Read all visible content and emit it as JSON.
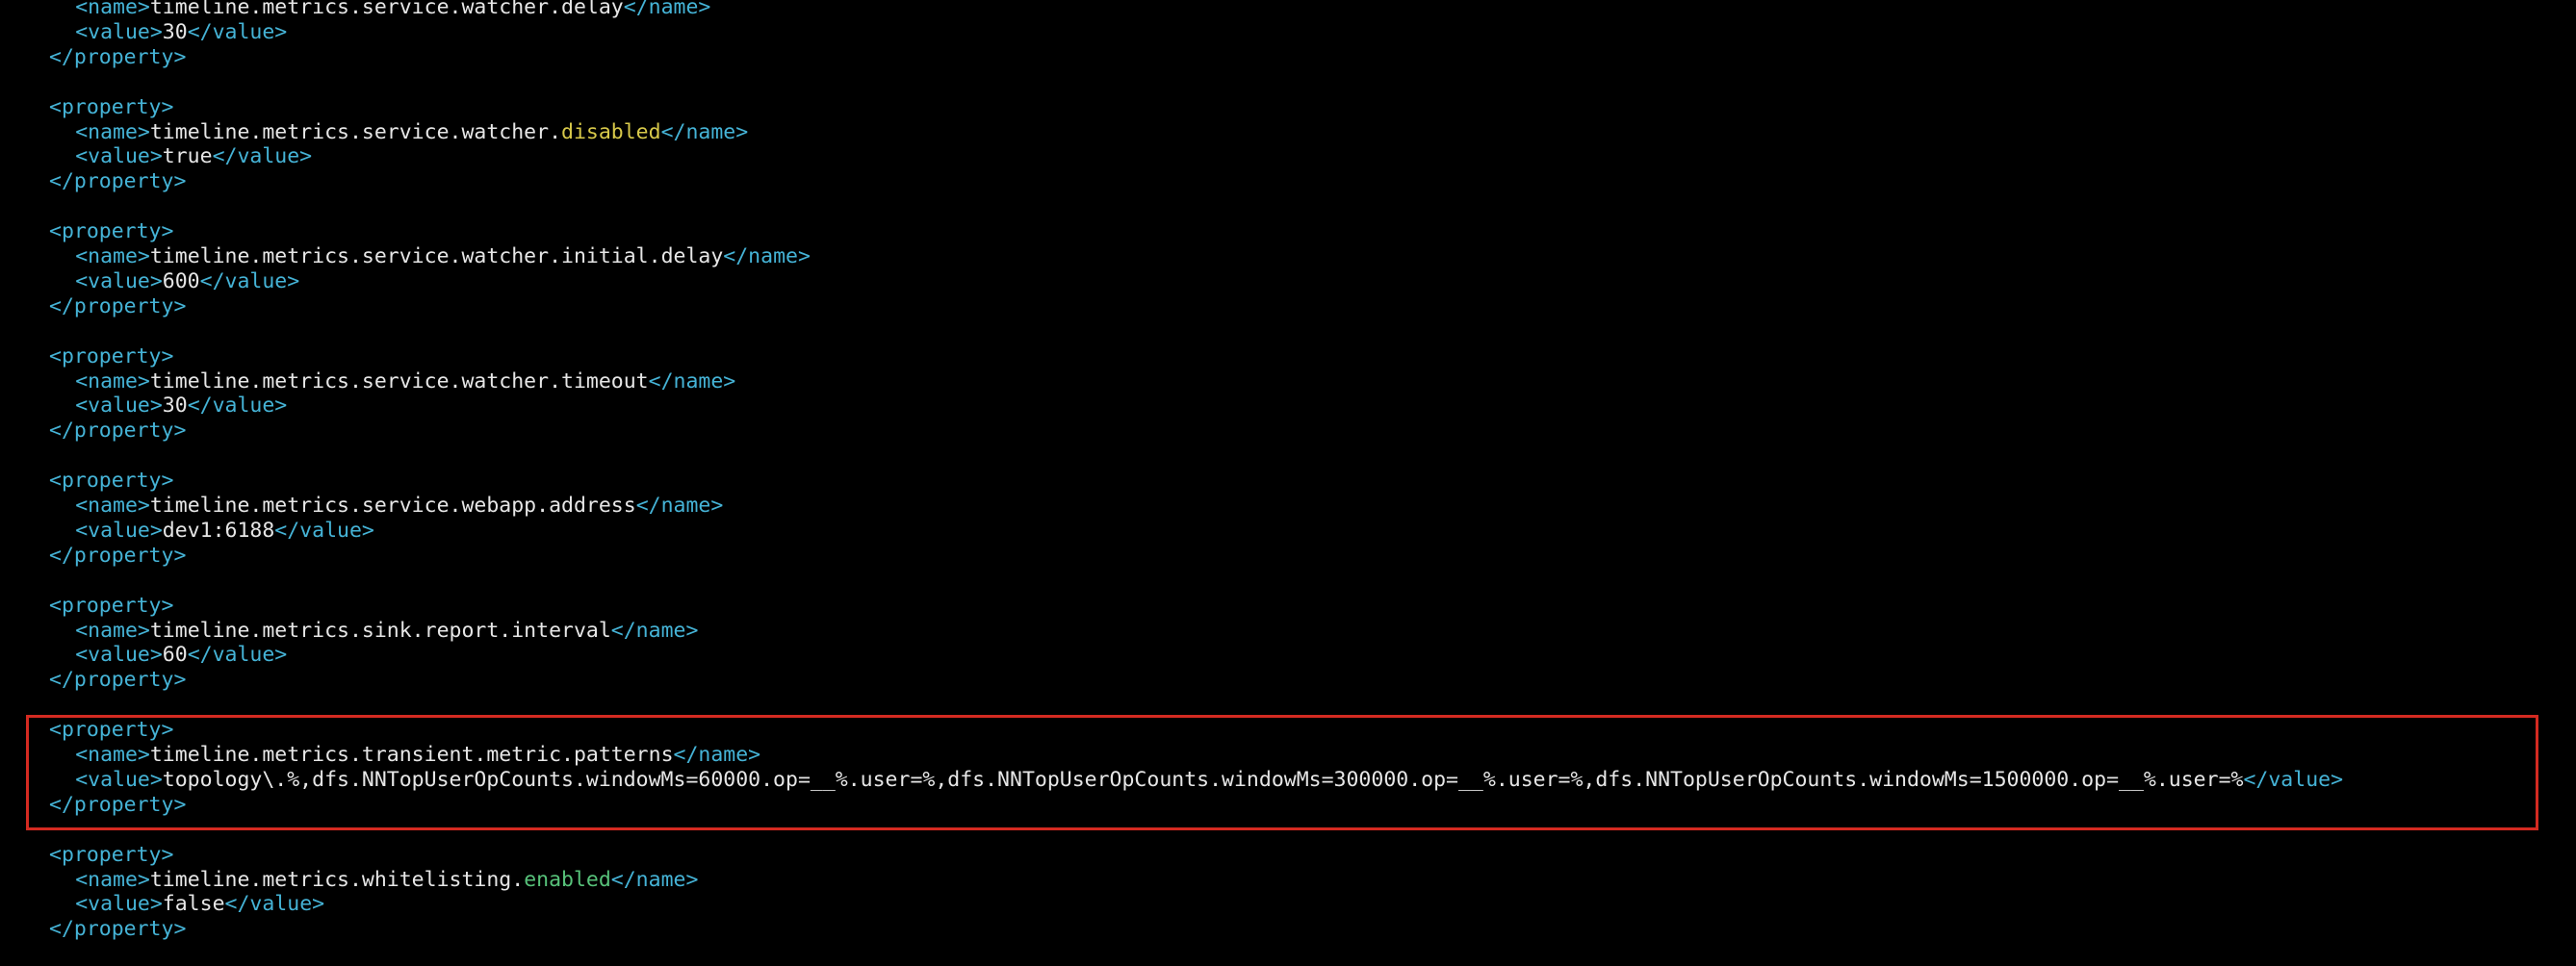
{
  "terminal": {
    "lines": [
      {
        "indent": 2,
        "parts": [
          {
            "t": "tag",
            "s": "<name>"
          },
          {
            "t": "txt",
            "s": "timeline.metrics.service.watcher.delay"
          },
          {
            "t": "tag",
            "s": "</name>"
          }
        ]
      },
      {
        "indent": 2,
        "parts": [
          {
            "t": "tag",
            "s": "<value>"
          },
          {
            "t": "txt",
            "s": "30"
          },
          {
            "t": "tag",
            "s": "</value>"
          }
        ]
      },
      {
        "indent": 0,
        "parts": [
          {
            "t": "tag",
            "s": "</property>"
          }
        ]
      },
      {
        "indent": 0,
        "parts": []
      },
      {
        "indent": 0,
        "parts": [
          {
            "t": "tag",
            "s": "<property>"
          }
        ]
      },
      {
        "indent": 2,
        "parts": [
          {
            "t": "tag",
            "s": "<name>"
          },
          {
            "t": "txt",
            "s": "timeline.metrics.service.watcher."
          },
          {
            "t": "kw-yellow",
            "s": "disabled"
          },
          {
            "t": "tag",
            "s": "</name>"
          }
        ]
      },
      {
        "indent": 2,
        "parts": [
          {
            "t": "tag",
            "s": "<value>"
          },
          {
            "t": "txt",
            "s": "true"
          },
          {
            "t": "tag",
            "s": "</value>"
          }
        ]
      },
      {
        "indent": 0,
        "parts": [
          {
            "t": "tag",
            "s": "</property>"
          }
        ]
      },
      {
        "indent": 0,
        "parts": []
      },
      {
        "indent": 0,
        "parts": [
          {
            "t": "tag",
            "s": "<property>"
          }
        ]
      },
      {
        "indent": 2,
        "parts": [
          {
            "t": "tag",
            "s": "<name>"
          },
          {
            "t": "txt",
            "s": "timeline.metrics.service.watcher.initial.delay"
          },
          {
            "t": "tag",
            "s": "</name>"
          }
        ]
      },
      {
        "indent": 2,
        "parts": [
          {
            "t": "tag",
            "s": "<value>"
          },
          {
            "t": "txt",
            "s": "600"
          },
          {
            "t": "tag",
            "s": "</value>"
          }
        ]
      },
      {
        "indent": 0,
        "parts": [
          {
            "t": "tag",
            "s": "</property>"
          }
        ]
      },
      {
        "indent": 0,
        "parts": []
      },
      {
        "indent": 0,
        "parts": [
          {
            "t": "tag",
            "s": "<property>"
          }
        ]
      },
      {
        "indent": 2,
        "parts": [
          {
            "t": "tag",
            "s": "<name>"
          },
          {
            "t": "txt",
            "s": "timeline.metrics.service.watcher.timeout"
          },
          {
            "t": "tag",
            "s": "</name>"
          }
        ]
      },
      {
        "indent": 2,
        "parts": [
          {
            "t": "tag",
            "s": "<value>"
          },
          {
            "t": "txt",
            "s": "30"
          },
          {
            "t": "tag",
            "s": "</value>"
          }
        ]
      },
      {
        "indent": 0,
        "parts": [
          {
            "t": "tag",
            "s": "</property>"
          }
        ]
      },
      {
        "indent": 0,
        "parts": []
      },
      {
        "indent": 0,
        "parts": [
          {
            "t": "tag",
            "s": "<property>"
          }
        ]
      },
      {
        "indent": 2,
        "parts": [
          {
            "t": "tag",
            "s": "<name>"
          },
          {
            "t": "txt",
            "s": "timeline.metrics.service.webapp.address"
          },
          {
            "t": "tag",
            "s": "</name>"
          }
        ]
      },
      {
        "indent": 2,
        "parts": [
          {
            "t": "tag",
            "s": "<value>"
          },
          {
            "t": "txt",
            "s": "dev1:6188"
          },
          {
            "t": "tag",
            "s": "</value>"
          }
        ]
      },
      {
        "indent": 0,
        "parts": [
          {
            "t": "tag",
            "s": "</property>"
          }
        ]
      },
      {
        "indent": 0,
        "parts": []
      },
      {
        "indent": 0,
        "parts": [
          {
            "t": "tag",
            "s": "<property>"
          }
        ]
      },
      {
        "indent": 2,
        "parts": [
          {
            "t": "tag",
            "s": "<name>"
          },
          {
            "t": "txt",
            "s": "timeline.metrics.sink.report.interval"
          },
          {
            "t": "tag",
            "s": "</name>"
          }
        ]
      },
      {
        "indent": 2,
        "parts": [
          {
            "t": "tag",
            "s": "<value>"
          },
          {
            "t": "txt",
            "s": "60"
          },
          {
            "t": "tag",
            "s": "</value>"
          }
        ]
      },
      {
        "indent": 0,
        "parts": [
          {
            "t": "tag",
            "s": "</property>"
          }
        ]
      },
      {
        "indent": 0,
        "parts": []
      },
      {
        "indent": 0,
        "parts": [
          {
            "t": "tag",
            "s": "<property>"
          }
        ]
      },
      {
        "indent": 2,
        "parts": [
          {
            "t": "tag",
            "s": "<name>"
          },
          {
            "t": "txt",
            "s": "timeline.metrics.transient.metric.patterns"
          },
          {
            "t": "tag",
            "s": "</name>"
          }
        ]
      },
      {
        "indent": 2,
        "parts": [
          {
            "t": "tag",
            "s": "<value>"
          },
          {
            "t": "txt",
            "s": "topology\\.%,dfs.NNTopUserOpCounts.windowMs=60000.op=__%.user=%,dfs.NNTopUserOpCounts.windowMs=300000.op=__%.user=%,dfs.NNTopUserOpCounts.windowMs=1500000.op=__%.user=%"
          },
          {
            "t": "tag",
            "s": "</value>"
          }
        ]
      },
      {
        "indent": 0,
        "parts": [
          {
            "t": "tag",
            "s": "</property>"
          }
        ]
      },
      {
        "indent": 0,
        "parts": []
      },
      {
        "indent": 0,
        "parts": [
          {
            "t": "tag",
            "s": "<property>"
          }
        ]
      },
      {
        "indent": 2,
        "parts": [
          {
            "t": "tag",
            "s": "<name>"
          },
          {
            "t": "txt",
            "s": "timeline.metrics.whitelisting."
          },
          {
            "t": "kw-green",
            "s": "enabled"
          },
          {
            "t": "tag",
            "s": "</name>"
          }
        ]
      },
      {
        "indent": 2,
        "parts": [
          {
            "t": "tag",
            "s": "<value>"
          },
          {
            "t": "txt",
            "s": "false"
          },
          {
            "t": "tag",
            "s": "</value>"
          }
        ]
      },
      {
        "indent": 0,
        "parts": [
          {
            "t": "tag",
            "s": "</property>"
          }
        ]
      }
    ]
  },
  "colors": {
    "background": "#000000",
    "tag": "#45b3d6",
    "text": "#e6e6e6",
    "keyword_disabled": "#d8c94a",
    "keyword_enabled": "#57c27a",
    "highlight_border": "#d42a21"
  }
}
